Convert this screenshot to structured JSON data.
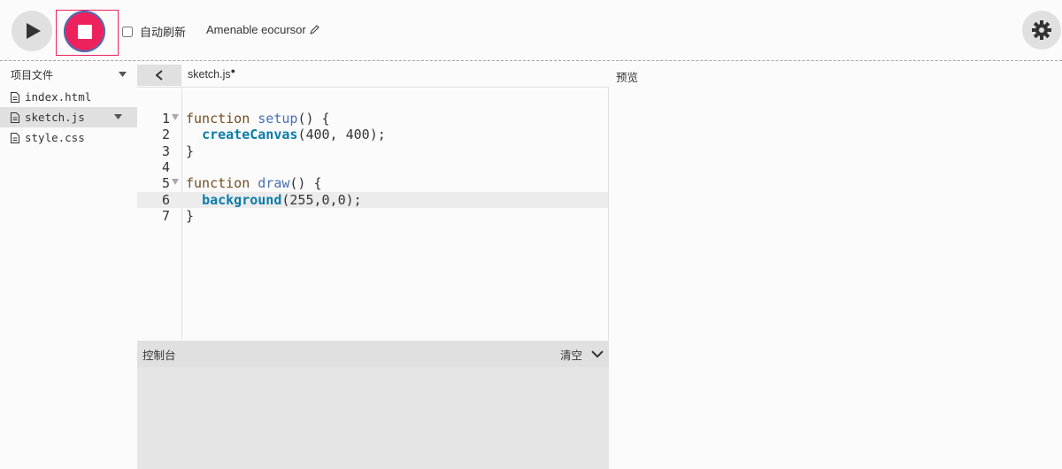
{
  "toolbar": {
    "autorefresh_label": "自动刷新",
    "autorefresh_checked": false,
    "project_name": "Amenable eocursor"
  },
  "sidebar": {
    "title": "项目文件",
    "files": [
      {
        "name": "index.html",
        "active": false
      },
      {
        "name": "sketch.js",
        "active": true
      },
      {
        "name": "style.css",
        "active": false
      }
    ]
  },
  "editor": {
    "tab_name": "sketch.js",
    "unsaved_marker": "●",
    "lines": [
      {
        "num": "1",
        "text": "function setup() {",
        "foldable": true
      },
      {
        "num": "2",
        "text": "  createCanvas(400, 400);",
        "foldable": false
      },
      {
        "num": "3",
        "text": "}",
        "foldable": false
      },
      {
        "num": "4",
        "text": "",
        "foldable": false
      },
      {
        "num": "5",
        "text": "function draw() {",
        "foldable": true
      },
      {
        "num": "6",
        "text": "  background(255,0,0);",
        "foldable": false
      },
      {
        "num": "7",
        "text": "}",
        "foldable": false
      }
    ],
    "highlighted_line": 6
  },
  "console": {
    "title": "控制台",
    "clear_label": "清空"
  },
  "preview": {
    "title": "预览"
  },
  "colors": {
    "accent": "#ed225d",
    "focus_ring": "#4a6fb5",
    "keyword": "#704f21",
    "function_def": "#4a6fb5",
    "builtin": "#0b7ca9"
  }
}
